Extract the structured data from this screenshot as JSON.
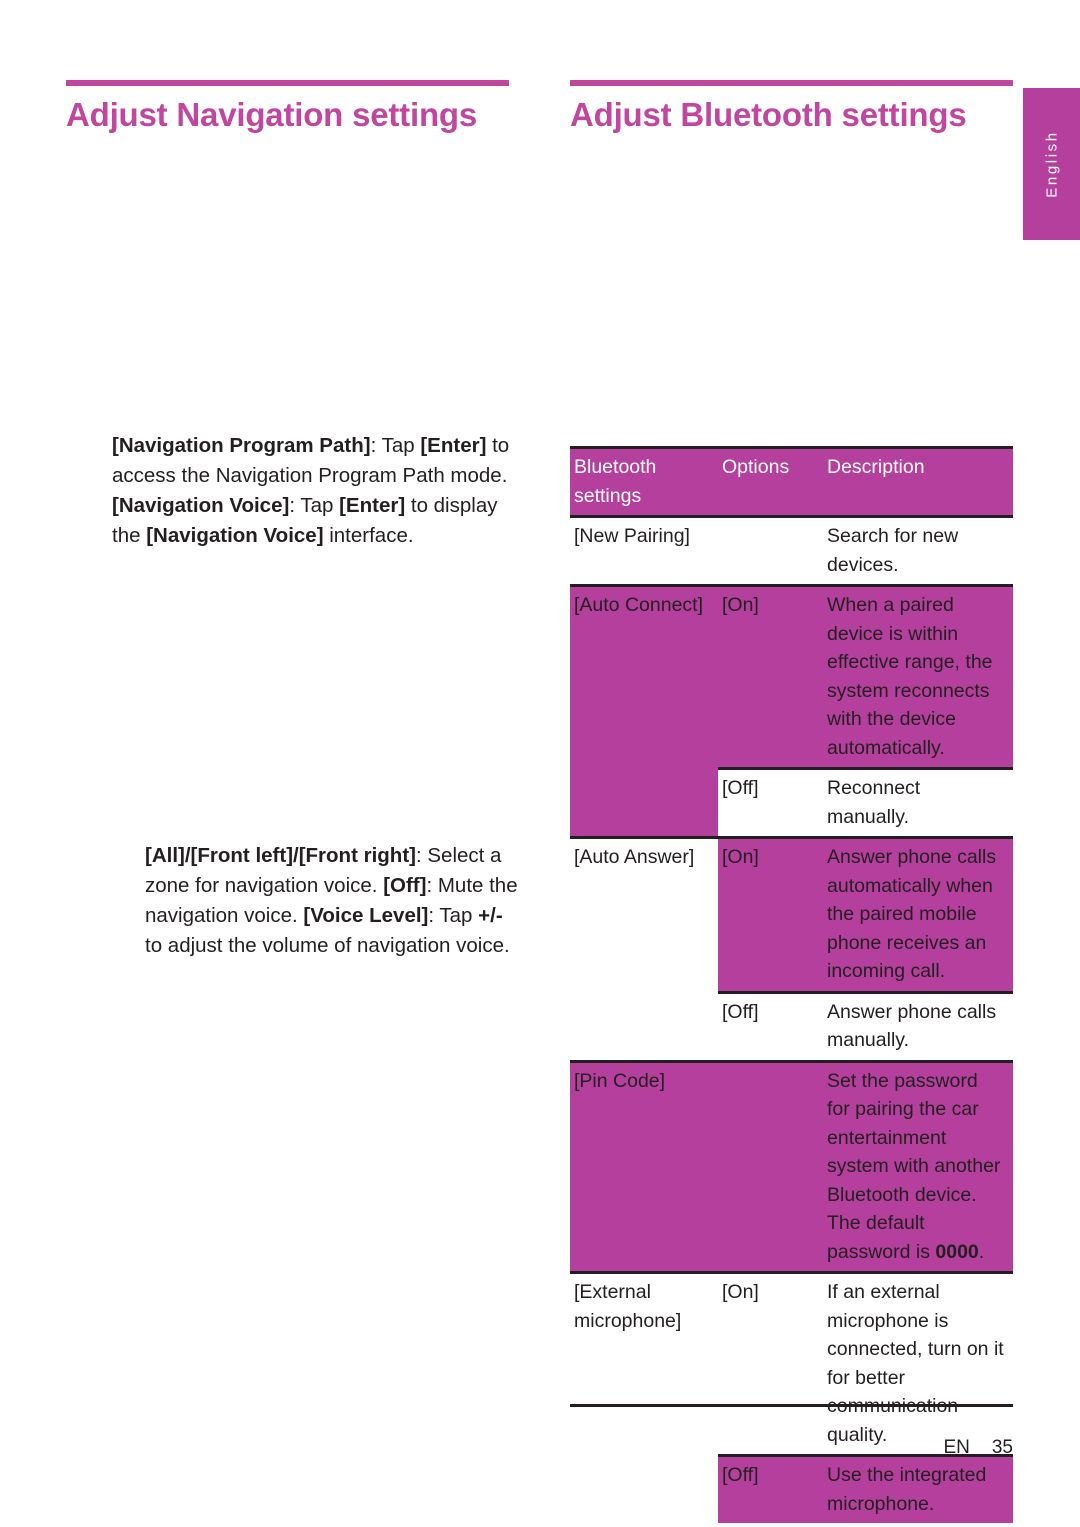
{
  "language_tab": {
    "label": "English"
  },
  "left_column": {
    "heading": "Adjust Navigation settings",
    "paragraphs": {
      "navigation": {
        "line1_bold": "[Navigation Program Path]",
        "line1_rest": ": Tap ",
        "line1_bold2": "[Enter]",
        "line1_tail": " to access the Navigation Program Path mode.",
        "line2_bold": "[Navigation Voice]",
        "line2_rest": ": Tap ",
        "line2_bold2": "[Enter]",
        "line2_tail": " to display the ",
        "line2_bold3": "[Navigation Voice]",
        "line2_tail2": " interface."
      },
      "voice": {
        "line1_bold": "[All]/[Front left]/[Front right]",
        "line1_tail": ": Select a zone for navigation voice.",
        "line2_bold": "[Off]",
        "line2_tail": ": Mute the navigation voice.",
        "line3_bold": "[Voice Level]",
        "line3_mid": ": Tap ",
        "line3_bold2": "+/-",
        "line3_tail": " to adjust the volume of navigation voice."
      }
    }
  },
  "right_column": {
    "heading": "Adjust Bluetooth settings",
    "table": {
      "headers": {
        "col1": "Bluetooth settings",
        "col2": "Options",
        "col3": "Description"
      },
      "rows": [
        {
          "setting": "[New Pairing]",
          "option": "",
          "description": "Search for new devices."
        },
        {
          "setting": "[Auto Connect]",
          "option": "[On]",
          "description": "When a paired device is within effective range, the system reconnects with the device automatically."
        },
        {
          "setting": "",
          "option": "[Off]",
          "description": "Reconnect manually."
        },
        {
          "setting": "[Auto Answer]",
          "option": "[On]",
          "description": "Answer phone calls automatically when the paired mobile phone receives an incoming call."
        },
        {
          "setting": "",
          "option": "[Off]",
          "description": "Answer phone calls manually."
        },
        {
          "setting": "[Pin Code]",
          "option": "",
          "description_pre": "Set the password for pairing the car entertainment system with another Bluetooth device. The default password is ",
          "description_bold": "0000",
          "description_post": "."
        },
        {
          "setting": "[External microphone]",
          "option": "[On]",
          "description": "If an external microphone is connected, turn on it for better communication quality."
        },
        {
          "setting": "",
          "option": "[Off]",
          "description": "Use the integrated microphone."
        }
      ]
    }
  },
  "footer": {
    "lang_code": "EN",
    "page_number": "35"
  },
  "colors": {
    "magenta": "#b53f9c",
    "heading_pink": "#c0469f",
    "text_dark": "#231f20"
  }
}
